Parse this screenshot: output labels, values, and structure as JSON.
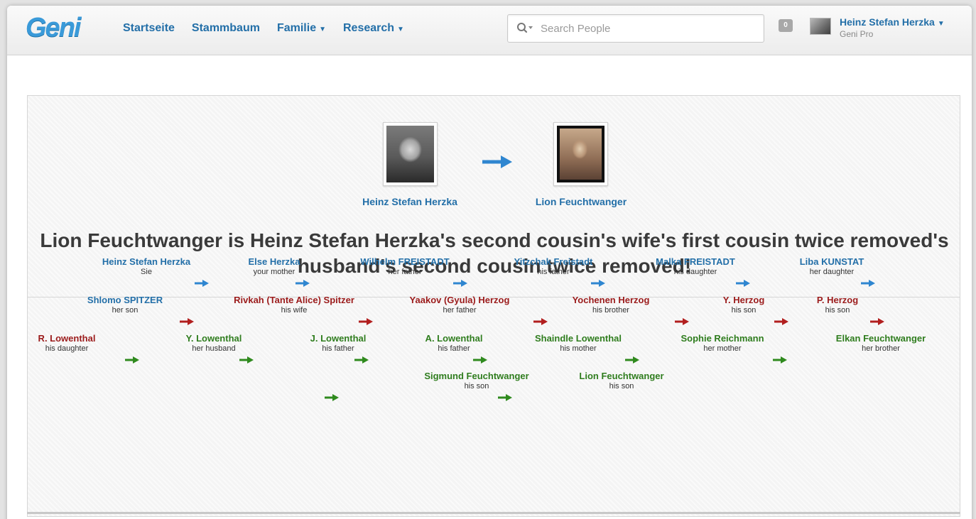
{
  "header": {
    "logo": "Geni",
    "nav": [
      {
        "label": "Startseite",
        "dropdown": false
      },
      {
        "label": "Stammbaum",
        "dropdown": false
      },
      {
        "label": "Familie",
        "dropdown": true
      },
      {
        "label": "Research",
        "dropdown": true
      }
    ],
    "search_placeholder": "Search People",
    "notification_count": "0",
    "user_name": "Heinz Stefan Herzka",
    "user_plan": "Geni Pro"
  },
  "relationship": {
    "from_name": "Heinz Stefan Herzka",
    "to_name": "Lion Feuchtwanger",
    "headline": "Lion Feuchtwanger is Heinz Stefan Herzka's second cousin's wife's first cousin twice removed's husband's second cousin twice removed!",
    "path": [
      {
        "name": "Heinz Stefan Herzka",
        "relation": "Sie",
        "color": "blue"
      },
      {
        "name": "Else Herzka",
        "relation": "your mother",
        "color": "blue"
      },
      {
        "name": "Wilhelm FREISTADT",
        "relation": "her father",
        "color": "blue"
      },
      {
        "name": "Yitzchak Freistadt",
        "relation": "his father",
        "color": "blue"
      },
      {
        "name": "Malka FREISTADT",
        "relation": "his daughter",
        "color": "blue"
      },
      {
        "name": "Liba KUNSTAT",
        "relation": "her daughter",
        "color": "blue"
      },
      {
        "name": "Shlomo SPITZER",
        "relation": "her son",
        "color": "blue"
      },
      {
        "name": "Rivkah (Tante Alice) Spitzer",
        "relation": "his wife",
        "color": "red"
      },
      {
        "name": "Yaakov (Gyula) Herzog",
        "relation": "her father",
        "color": "red"
      },
      {
        "name": "Yochenen Herzog",
        "relation": "his brother",
        "color": "red"
      },
      {
        "name": "Y. Herzog",
        "relation": "his son",
        "color": "red"
      },
      {
        "name": "P. Herzog",
        "relation": "his son",
        "color": "red"
      },
      {
        "name": "R. Lowenthal",
        "relation": "his daughter",
        "color": "red"
      },
      {
        "name": "Y. Lowenthal",
        "relation": "her husband",
        "color": "green"
      },
      {
        "name": "J. Lowenthal",
        "relation": "his father",
        "color": "green"
      },
      {
        "name": "A. Lowenthal",
        "relation": "his father",
        "color": "green"
      },
      {
        "name": "Shaindle Lowenthal",
        "relation": "his mother",
        "color": "green"
      },
      {
        "name": "Sophie Reichmann",
        "relation": "her mother",
        "color": "green"
      },
      {
        "name": "Elkan Feuchtwanger",
        "relation": "her brother",
        "color": "green"
      },
      {
        "name": "Sigmund Feuchtwanger",
        "relation": "his son",
        "color": "green"
      },
      {
        "name": "Lion Feuchtwanger",
        "relation": "his son",
        "color": "green"
      }
    ]
  },
  "colors": {
    "blue": "#236fa8",
    "red": "#9b1b1b",
    "green": "#2f7d1e",
    "arrow_blue": "#2f86d0",
    "arrow_red": "#b21f1f",
    "arrow_green": "#2f8a1e"
  }
}
